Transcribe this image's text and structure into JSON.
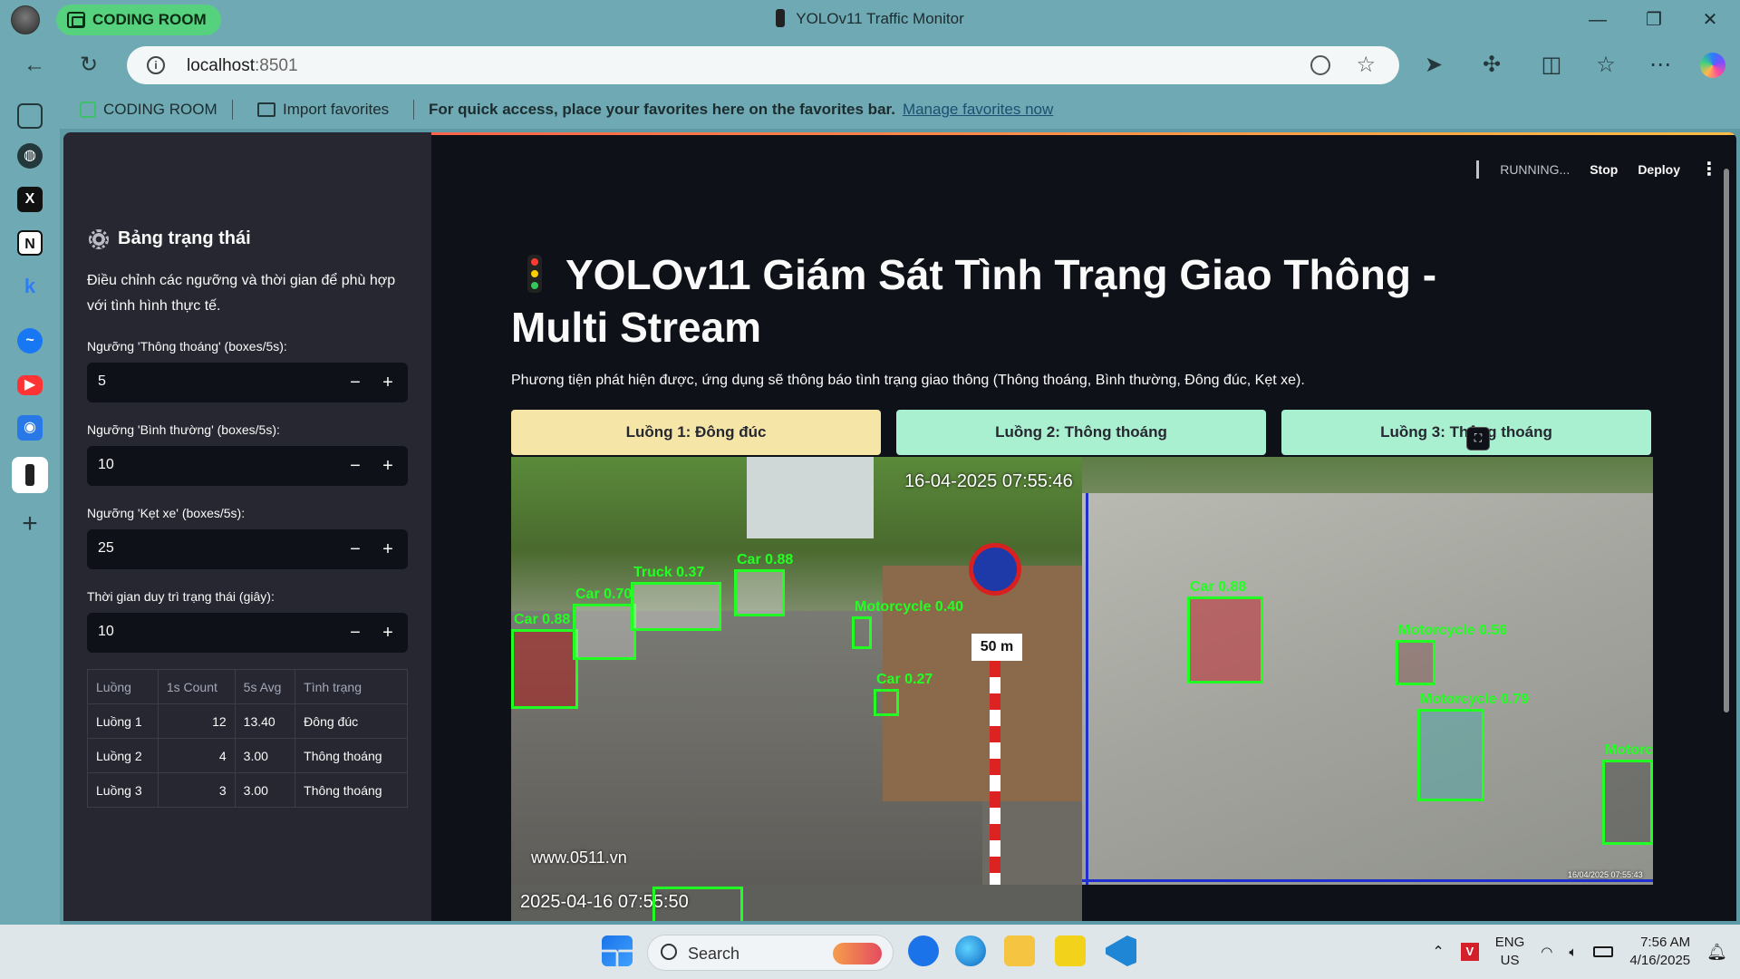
{
  "browser": {
    "workspace_label": "CODING ROOM",
    "window_title": "YOLOv11 Traffic Monitor",
    "url_host": "localhost",
    "url_port": ":8501",
    "favorites": {
      "workspace": "CODING ROOM",
      "import": "Import favorites",
      "prompt": "For quick access, place your favorites here on the favorites bar.",
      "manage_link": "Manage favorites now"
    }
  },
  "rail": {
    "items": [
      "tab-actions-icon",
      "github-icon",
      "x-icon",
      "notion-icon",
      "k-icon",
      "messenger-icon",
      "youtube-icon",
      "copilot-icon",
      "traffic-light-icon",
      "add-icon"
    ]
  },
  "sidebar": {
    "title": "Bảng trạng thái",
    "description": "Điều chỉnh các ngưỡng và thời gian để phù hợp với tình hình thực tế.",
    "inputs": [
      {
        "label": "Ngưỡng 'Thông thoáng' (boxes/5s):",
        "value": "5"
      },
      {
        "label": "Ngưỡng 'Bình thường' (boxes/5s):",
        "value": "10"
      },
      {
        "label": "Ngưỡng 'Kẹt xe' (boxes/5s):",
        "value": "25"
      },
      {
        "label": "Thời gian duy trì trạng thái (giây):",
        "value": "10"
      }
    ],
    "minus": "−",
    "plus": "+",
    "table": {
      "headers": [
        "Luồng",
        "1s Count",
        "5s Avg",
        "Tình trạng"
      ],
      "rows": [
        [
          "Luồng 1",
          "12",
          "13.40",
          "Đông đúc"
        ],
        [
          "Luồng 2",
          "4",
          "3.00",
          "Thông thoáng"
        ],
        [
          "Luồng 3",
          "3",
          "3.00",
          "Thông thoáng"
        ]
      ]
    }
  },
  "header": {
    "status": "RUNNING...",
    "stop": "Stop",
    "deploy": "Deploy",
    "menu": "⋮"
  },
  "main": {
    "title": "YOLOv11 Giám Sát Tình Trạng Giao Thông - Multi Stream",
    "subtitle": "Phương tiện phát hiện được, ứng dụng sẽ thông báo tình trạng giao thông (Thông thoáng, Bình thường, Đông đúc, Kẹt xe).",
    "streams": [
      {
        "label": "Luồng 1: Đông đúc",
        "color": "#f5e6a8"
      },
      {
        "label": "Luồng 2: Thông thoáng",
        "color": "#a8f0cf"
      },
      {
        "label": "Luồng 3: Thông thoáng",
        "color": "#a8f0cf"
      }
    ],
    "feed1": {
      "timestamp": "16-04-2025 07:55:46",
      "watermark": "www.0511.vn",
      "sign": "50 m",
      "detections": [
        "Car 0.88",
        "Car 0.70",
        "Truck 0.37",
        "Car 0.88",
        "Motorcycle 0.40",
        "Car 0.27"
      ]
    },
    "feed2": {
      "timestamp": "16/04/2025 07:55:43",
      "detections": [
        "Car 0.88",
        "Motorcycle 0.56",
        "Motorcycle 0.79",
        "Motorc"
      ]
    },
    "feed3": {
      "timestamp": "2025-04-16 07:55:50"
    }
  },
  "taskbar": {
    "search": "Search",
    "lang_top": "ENG",
    "lang_bottom": "US",
    "time": "7:56 AM",
    "date": "4/16/2025"
  }
}
